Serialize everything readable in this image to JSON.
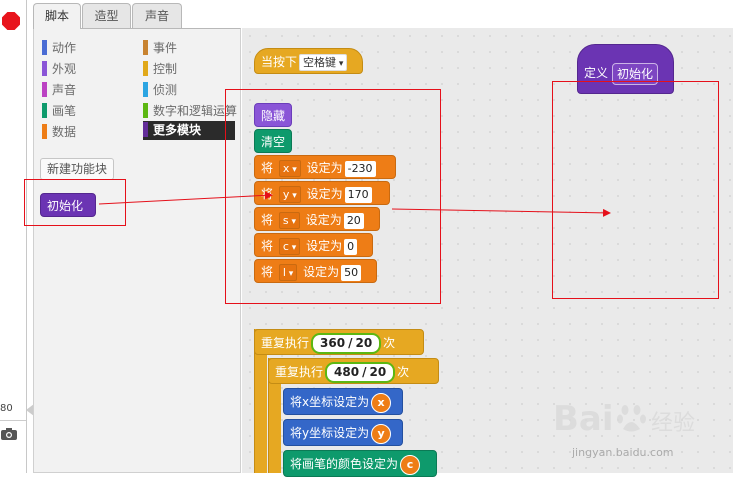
{
  "tabs": [
    "脚本",
    "造型",
    "声音"
  ],
  "categories_left": [
    {
      "label": "动作",
      "color": "#4a6cd4"
    },
    {
      "label": "外观",
      "color": "#8a55d7"
    },
    {
      "label": "声音",
      "color": "#bb42c3"
    },
    {
      "label": "画笔",
      "color": "#0e9a6c"
    },
    {
      "label": "数据",
      "color": "#ee7d16"
    }
  ],
  "categories_right": [
    {
      "label": "事件",
      "color": "#c88330"
    },
    {
      "label": "控制",
      "color": "#e1a91a"
    },
    {
      "label": "侦测",
      "color": "#2ca5e2"
    },
    {
      "label": "数字和逻辑运算",
      "color": "#5cb712"
    },
    {
      "label": "更多模块",
      "color": "#632d99"
    }
  ],
  "palette": {
    "new_block_label": "新建功能块",
    "custom_block_label": "初始化"
  },
  "stage_strip": {
    "scroll_value": "80"
  },
  "scripts": {
    "hat": {
      "label": "当按下",
      "key": "空格键"
    },
    "hide_label": "隐藏",
    "clear_label": "清空",
    "set_vars": [
      {
        "prefix": "将",
        "var": "x",
        "mid": "设定为",
        "value": "-230"
      },
      {
        "prefix": "将",
        "var": "y",
        "mid": "设定为",
        "value": "170"
      },
      {
        "prefix": "将",
        "var": "s",
        "mid": "设定为",
        "value": "20"
      },
      {
        "prefix": "将",
        "var": "c",
        "mid": "设定为",
        "value": "0"
      },
      {
        "prefix": "将",
        "var": "l",
        "mid": "设定为",
        "value": "50"
      }
    ],
    "repeat_outer": {
      "label": "重复执行",
      "a": "360",
      "op": "/",
      "b": "20",
      "suffix": "次"
    },
    "repeat_inner": {
      "label": "重复执行",
      "a": "480",
      "op": "/",
      "b": "20",
      "suffix": "次"
    },
    "set_x": {
      "label": "将x坐标设定为",
      "var": "x"
    },
    "set_y": {
      "label": "将y坐标设定为",
      "var": "y"
    },
    "set_pen_color": {
      "label": "将画笔的颜色设定为",
      "var": "c"
    },
    "define": {
      "label": "定义",
      "name": "初始化"
    }
  },
  "watermark": {
    "brand": "Bai",
    "brand_cn": "经验",
    "site": "jingyan.baidu.com"
  },
  "colors": {
    "annotation_red": "#e5101a",
    "more_blocks_bg": "#2b2b2b"
  }
}
